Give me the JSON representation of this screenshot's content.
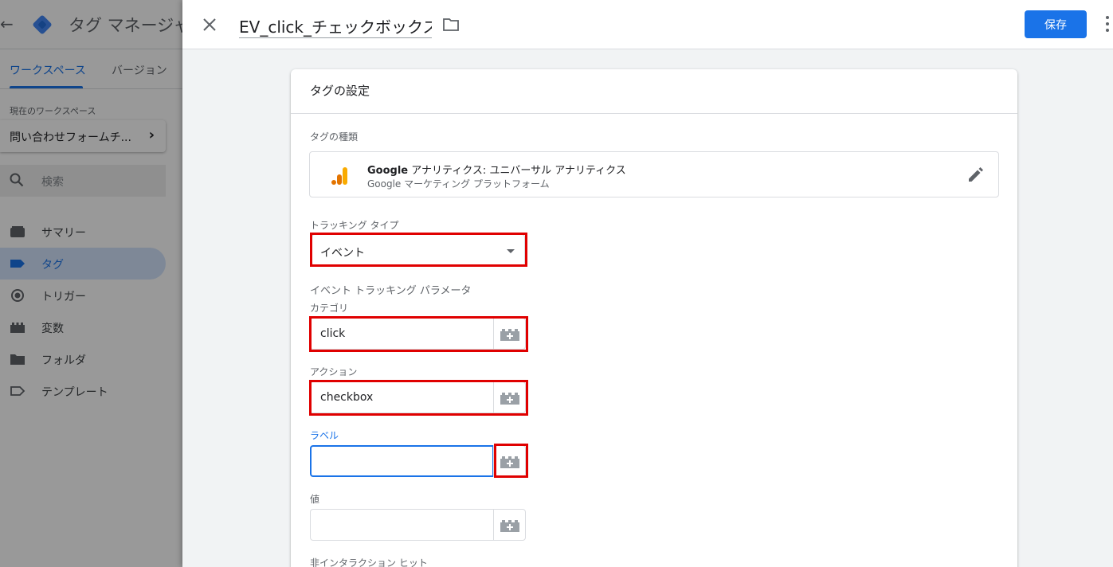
{
  "background": {
    "app_title": "タグ マネージャー",
    "tabs": [
      {
        "label": "ワークスペース",
        "active": true
      },
      {
        "label": "バージョン",
        "active": false
      }
    ],
    "workspace_label": "現在のワークスペース",
    "workspace_name": "問い合わせフォームチ...",
    "search_placeholder": "検索",
    "nav": [
      {
        "label": "サマリー",
        "icon": "summary-icon",
        "active": false
      },
      {
        "label": "タグ",
        "icon": "tag-icon",
        "active": true
      },
      {
        "label": "トリガー",
        "icon": "trigger-icon",
        "active": false
      },
      {
        "label": "変数",
        "icon": "variables-icon",
        "active": false
      },
      {
        "label": "フォルダ",
        "icon": "folder-icon",
        "active": false
      },
      {
        "label": "テンプレート",
        "icon": "template-icon",
        "active": false
      }
    ]
  },
  "header": {
    "tag_name": "EV_click_チェックボックス",
    "save_label": "保存"
  },
  "card": {
    "title": "タグの設定",
    "tag_type_label": "タグの種類",
    "tag_type": {
      "brand": "Google",
      "name_rest": " アナリティクス: ユニバーサル アナリティクス",
      "sub": "Google マーケティング プラットフォーム"
    },
    "tracking_type_label": "トラッキング タイプ",
    "tracking_type_value": "イベント",
    "event_params_label": "イベント トラッキング パラメータ",
    "fields": [
      {
        "label": "カテゴリ",
        "value": "click",
        "focused": false
      },
      {
        "label": "アクション",
        "value": "checkbox",
        "focused": false
      },
      {
        "label": "ラベル",
        "value": "",
        "focused": true
      },
      {
        "label": "値",
        "value": "",
        "focused": false
      }
    ],
    "non_interaction_label": "非インタラクション ヒット"
  },
  "colors": {
    "accent": "#1a73e8",
    "highlight": "#e00000",
    "ga_orange": "#f9ab00",
    "ga_dark_orange": "#e37400"
  }
}
